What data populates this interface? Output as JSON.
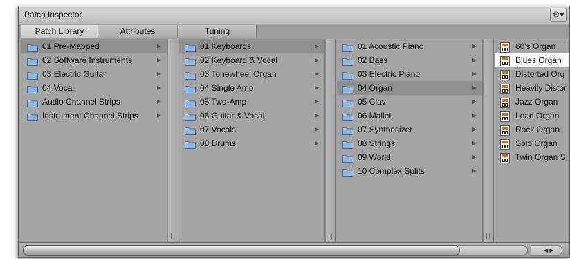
{
  "window": {
    "title": "Patch Inspector",
    "gear_glyph": "⚙▾"
  },
  "tabs": [
    {
      "label": "Patch Library",
      "active": true
    },
    {
      "label": "Attributes",
      "active": false
    },
    {
      "label": "Tuning",
      "active": false
    }
  ],
  "columns": [
    {
      "items": [
        {
          "label": "01 Pre-Mapped",
          "arrow": true,
          "selected": true
        },
        {
          "label": "02 Software Instruments",
          "arrow": true
        },
        {
          "label": "03 Electric Guitar",
          "arrow": true
        },
        {
          "label": "04 Vocal",
          "arrow": true
        },
        {
          "label": "Audio Channel Strips",
          "arrow": true
        },
        {
          "label": "Instrument Channel Strips",
          "arrow": true
        }
      ]
    },
    {
      "items": [
        {
          "label": "01 Keyboards",
          "arrow": true,
          "selected": true
        },
        {
          "label": "02 Keyboard & Vocal",
          "arrow": true
        },
        {
          "label": "03 Tonewheel Organ",
          "arrow": true
        },
        {
          "label": "04 Single Amp",
          "arrow": true
        },
        {
          "label": "05 Two-Amp",
          "arrow": true
        },
        {
          "label": "06 Guitar & Vocal",
          "arrow": true
        },
        {
          "label": "07 Vocals",
          "arrow": true
        },
        {
          "label": "08 Drums",
          "arrow": true
        }
      ]
    },
    {
      "items": [
        {
          "label": "01 Acoustic Piano",
          "arrow": true
        },
        {
          "label": "02 Bass",
          "arrow": true
        },
        {
          "label": "03 Electric Piano",
          "arrow": true
        },
        {
          "label": "04 Organ",
          "arrow": true,
          "selected": true
        },
        {
          "label": "05 Clav",
          "arrow": true
        },
        {
          "label": "06 Mallet",
          "arrow": true
        },
        {
          "label": "07 Synthesizer",
          "arrow": true
        },
        {
          "label": "08 Strings",
          "arrow": true
        },
        {
          "label": "09 World",
          "arrow": true
        },
        {
          "label": "10 Complex Splits",
          "arrow": true
        }
      ]
    },
    {
      "items": [
        {
          "label": "60's Organ"
        },
        {
          "label": "Blues Organ",
          "highlighted": true
        },
        {
          "label": "Distorted Org"
        },
        {
          "label": "Heavily Distor"
        },
        {
          "label": "Jazz Organ"
        },
        {
          "label": "Lead Organ"
        },
        {
          "label": "Rock Organ"
        },
        {
          "label": "Solo Organ"
        },
        {
          "label": "Twin Organ S"
        }
      ]
    }
  ],
  "icons": {
    "folder": "folder-icon",
    "patch": "patch-icon",
    "disclosure": "▶"
  },
  "scrollbar": {
    "arrows": "◀ ▶"
  }
}
